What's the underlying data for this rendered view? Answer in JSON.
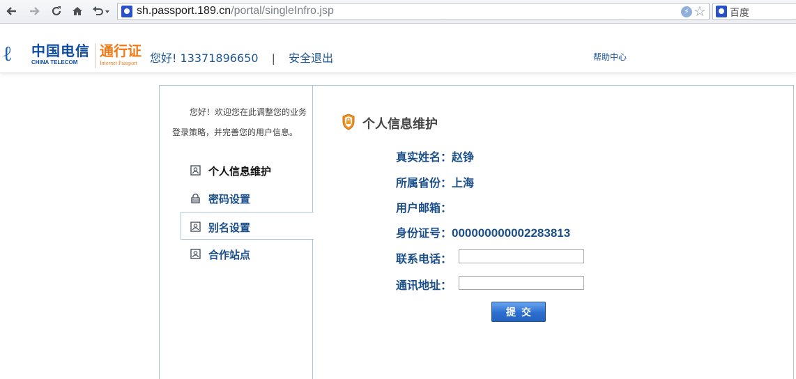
{
  "browser": {
    "url_domain": "sh.passport.189.cn",
    "url_path": "/portal/singleInfro.jsp",
    "search_engine": "百度"
  },
  "header": {
    "brand_cn": "中国电信",
    "brand_en": "CHINA TELECOM",
    "passport_cn": "通行证",
    "passport_en": "Internet Passport",
    "greeting": "您好!",
    "phone": "13371896650",
    "separator": "|",
    "logout_label": "安全退出",
    "help_label": "帮助中心"
  },
  "sidebar": {
    "welcome_text": "您好！欢迎您在此调整您的业务登录策略，并完善您的用户信息。",
    "items": [
      {
        "label": "个人信息维护",
        "icon": "id-card-icon"
      },
      {
        "label": "密码设置",
        "icon": "lock-icon"
      },
      {
        "label": "别名设置",
        "icon": "id-card-icon"
      },
      {
        "label": "合作站点",
        "icon": "id-card-icon"
      }
    ]
  },
  "main": {
    "title": "个人信息维护",
    "fields": {
      "name_label": "真实姓名：",
      "name_value": "赵铮",
      "province_label": "所属省份：",
      "province_value": "上海",
      "email_label": "用户邮箱：",
      "email_value": "",
      "idcard_label": "身份证号：",
      "idcard_value": "000000000002283813",
      "phone_label": "联系电话：",
      "phone_value": "",
      "address_label": "通讯地址：",
      "address_value": ""
    },
    "submit_label": "提交"
  },
  "colors": {
    "brand_blue": "#0e4da4",
    "passport_orange": "#f07a16",
    "link_blue": "#1b5596",
    "panel_border": "#a9c4db",
    "button_blue": "#2c6fd0"
  }
}
